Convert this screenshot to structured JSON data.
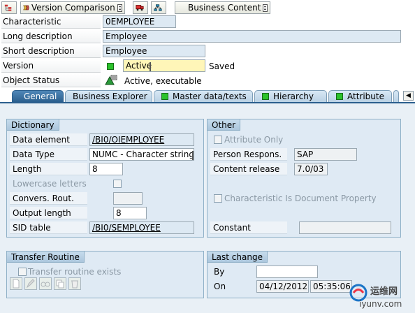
{
  "toolbar": {
    "version_comparison_label": "Version Comparison",
    "business_content_label": "Business Content"
  },
  "header": {
    "characteristic_label": "Characteristic",
    "characteristic_value": "0EMPLOYEE",
    "long_desc_label": "Long description",
    "long_desc_value": "Employee",
    "short_desc_label": "Short description",
    "short_desc_value": "Employee",
    "version_label": "Version",
    "version_value": "Active",
    "version_status": "Saved",
    "object_status_label": "Object Status",
    "object_status_value": "Active, executable"
  },
  "tabs": {
    "general": "General",
    "business_explorer": "Business Explorer",
    "master_data": "Master data/texts",
    "hierarchy": "Hierarchy",
    "attribute": "Attribute"
  },
  "dictionary": {
    "title": "Dictionary",
    "data_element_label": "Data element",
    "data_element_value": "/BI0/OIEMPLOYEE",
    "data_type_label": "Data Type",
    "data_type_value": "NUMC - Character string",
    "length_label": "Length",
    "length_value": "8",
    "lowercase_label": "Lowercase letters",
    "convers_label": "Convers. Rout.",
    "convers_value": "",
    "output_length_label": "Output length",
    "output_length_value": "8",
    "sid_table_label": "SID table",
    "sid_table_value": "/BI0/SEMPLOYEE"
  },
  "other": {
    "title": "Other",
    "attribute_only_label": "Attribute Only",
    "person_respons_label": "Person Respons.",
    "person_respons_value": "SAP",
    "content_release_label": "Content release",
    "content_release_value": "7.0/03",
    "char_doc_prop_label": "Characteristic Is Document Property",
    "constant_label": "Constant",
    "constant_value": ""
  },
  "transfer": {
    "title": "Transfer Routine",
    "exists_label": "Transfer routine exists"
  },
  "last_change": {
    "title": "Last change",
    "by_label": "By",
    "by_value": "",
    "on_label": "On",
    "date_value": "04/12/2012",
    "time_value": "05:35:06"
  },
  "watermark": {
    "cn": "运维网",
    "url": "iyunv.com"
  },
  "colors": {
    "active_tab": "#2b5f8e",
    "panel_bg": "#dfeaf4",
    "field_bg": "#dde9f3",
    "status_green": "#2cc22c",
    "version_yellow": "#fff6b8"
  }
}
